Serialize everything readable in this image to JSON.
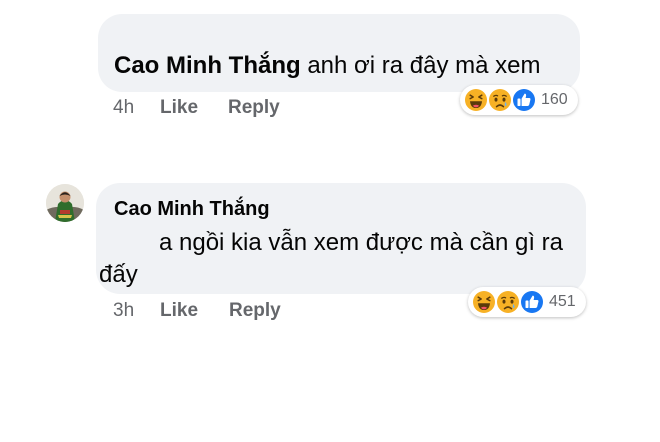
{
  "comments": [
    {
      "author": "Cao Minh Thắng",
      "text": "anh ơi ra đây mà xem",
      "time": "4h",
      "like_label": "Like",
      "reply_label": "Reply",
      "reactions": [
        "haha-icon",
        "sad-icon",
        "like-icon"
      ],
      "reaction_count": "160"
    },
    {
      "author": "Cao Minh Thắng",
      "text": "a ngồi kia vẫn xem được mà cần gì ra đấy",
      "time": "3h",
      "like_label": "Like",
      "reply_label": "Reply",
      "reactions": [
        "haha-icon",
        "sad-icon",
        "like-icon"
      ],
      "reaction_count": "451"
    }
  ],
  "colors": {
    "bubble": "#f0f2f5",
    "meta_text": "#65676b",
    "like_blue": "#1877f2",
    "emoji_yellow": "#f7b125"
  }
}
